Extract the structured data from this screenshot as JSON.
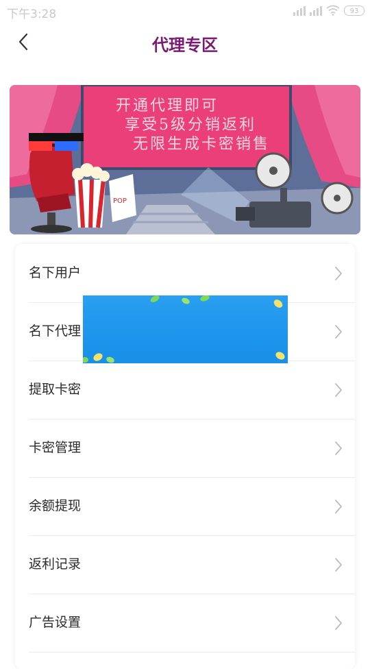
{
  "status_bar": {
    "time": "下午3:28",
    "battery": "93"
  },
  "header": {
    "title": "代理专区"
  },
  "banner": {
    "lines": [
      "开通代理即可",
      "享受5级分销返利",
      "无限生成卡密销售"
    ],
    "popcorn_text": "POP CORN"
  },
  "menu": {
    "items": [
      {
        "label": "名下用户"
      },
      {
        "label": "名下代理"
      },
      {
        "label": "提取卡密"
      },
      {
        "label": "卡密管理"
      },
      {
        "label": "余额提现"
      },
      {
        "label": "返利记录"
      },
      {
        "label": "广告设置"
      }
    ]
  },
  "colors": {
    "title": "#7a1a73",
    "banner_screen": "#ea3f78",
    "ad_blue": "#2196ee"
  }
}
